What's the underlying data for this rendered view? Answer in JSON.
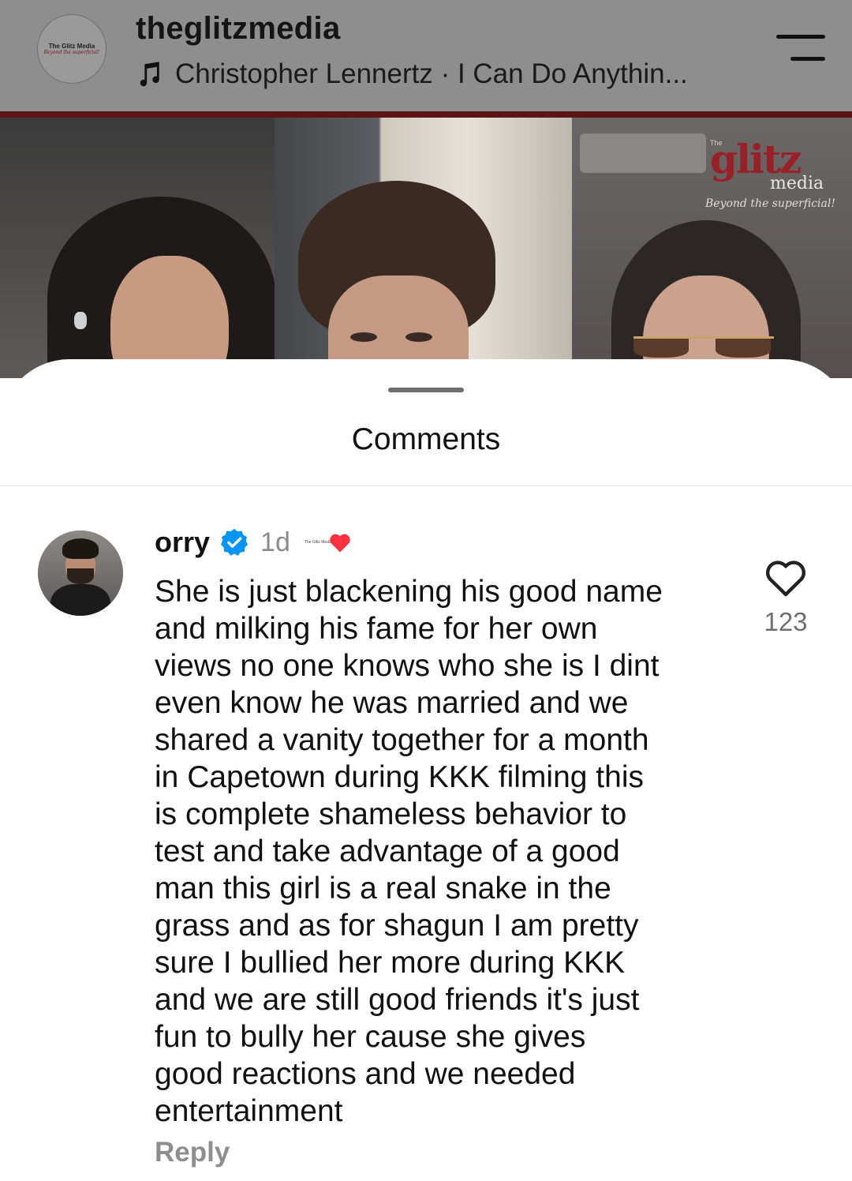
{
  "header": {
    "account_name": "theglitzmedia",
    "avatar_text_line1": "The Glitz Media",
    "avatar_text_line2": "Beyond the superficial!",
    "music_text": "Christopher Lennertz · I Can Do Anythin...",
    "icons": {
      "music": "music-note-icon",
      "menu": "menu-icon"
    }
  },
  "video": {
    "watermark_the": "The",
    "watermark_brand": "glitz",
    "watermark_media": "media",
    "watermark_tagline": "Beyond the superficial!",
    "accent_color": "#9b1f26"
  },
  "comments_sheet": {
    "title": "Comments",
    "comments": [
      {
        "username": "orry",
        "verified": true,
        "time": "1d",
        "text": "She is just blackening his good name\nand milking his fame for her own\nviews no one knows who she is I dint\neven know he was married and we\nshared a vanity together for a month\nin Capetown during KKK filming this\nis complete shameless behavior to\ntest and take advantage of a good\nman this girl is a real snake in the\ngrass and as for shagun I am pretty\nsure I bullied her more during KKK\nand we are still good friends it's just\nfun to bully her cause she gives\ngood reactions and we needed\nentertainment",
        "reply_label": "Reply",
        "like_count": "123",
        "creator_liked": true,
        "creator_logo_text": "The Glitz Media"
      }
    ]
  },
  "colors": {
    "verified_blue": "#0095f6",
    "heart_red": "#ff3040",
    "header_gray": "#8e8e8e",
    "stripe_red": "#5d1414"
  }
}
